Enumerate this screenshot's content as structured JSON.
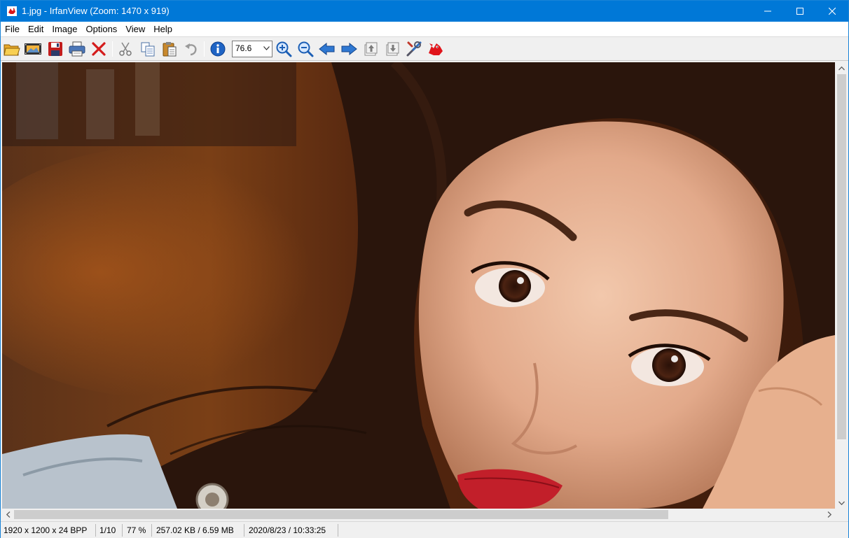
{
  "window": {
    "title": "1.jpg - IrfanView (Zoom: 1470 x 919)",
    "accent_color": "#0078d7",
    "controls": {
      "minimize_icon": "minimize-icon",
      "maximize_icon": "maximize-icon",
      "close_icon": "close-icon"
    }
  },
  "menu": {
    "items": [
      {
        "label": "File"
      },
      {
        "label": "Edit"
      },
      {
        "label": "Image"
      },
      {
        "label": "Options"
      },
      {
        "label": "View"
      },
      {
        "label": "Help"
      }
    ]
  },
  "toolbar": {
    "buttons": [
      {
        "icon": "open-folder-icon"
      },
      {
        "icon": "slideshow-icon"
      },
      {
        "icon": "save-icon"
      },
      {
        "icon": "print-icon"
      },
      {
        "icon": "delete-icon"
      },
      {
        "icon": "cut-icon"
      },
      {
        "icon": "copy-icon"
      },
      {
        "icon": "paste-icon"
      },
      {
        "icon": "undo-icon"
      },
      {
        "icon": "info-icon"
      },
      {
        "icon": "zoom-in-icon"
      },
      {
        "icon": "zoom-out-icon"
      },
      {
        "icon": "previous-icon"
      },
      {
        "icon": "next-icon"
      },
      {
        "icon": "first-file-icon"
      },
      {
        "icon": "last-file-icon"
      },
      {
        "icon": "settings-icon"
      },
      {
        "icon": "irfanview-logo-icon"
      }
    ],
    "zoom_value": "76.6"
  },
  "image": {
    "description_icon": "photo-image"
  },
  "statusbar": {
    "dimensions": "1920 x 1200 x 24 BPP",
    "index": "1/10",
    "zoom": "77 %",
    "size": "257.02 KB / 6.59 MB",
    "datetime": "2020/8/23 / 10:33:25"
  }
}
